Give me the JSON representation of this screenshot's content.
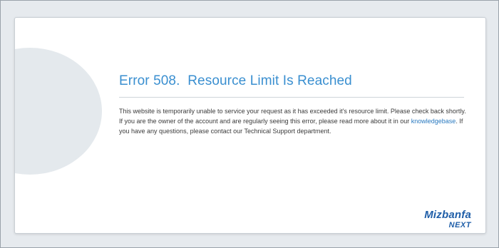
{
  "error": {
    "title": "Error 508.  Resource Limit Is Reached",
    "line1": "This website is temporarily unable to service your request as it has exceeded it's resource limit. Please check back shortly.",
    "line2_before": "If you are the owner of the account and are regularly seeing this error, please read more about it in our ",
    "link_text": "knowledgebase",
    "line2_after": ". If you have any questions, please contact our Technical Support department."
  },
  "logo": {
    "top": "Mizbanfa",
    "bottom": "NEXT"
  },
  "colors": {
    "title": "#3a8fd0",
    "link": "#2a7ac0",
    "logo": "#1f5ea8",
    "background": "#e6eaee"
  }
}
